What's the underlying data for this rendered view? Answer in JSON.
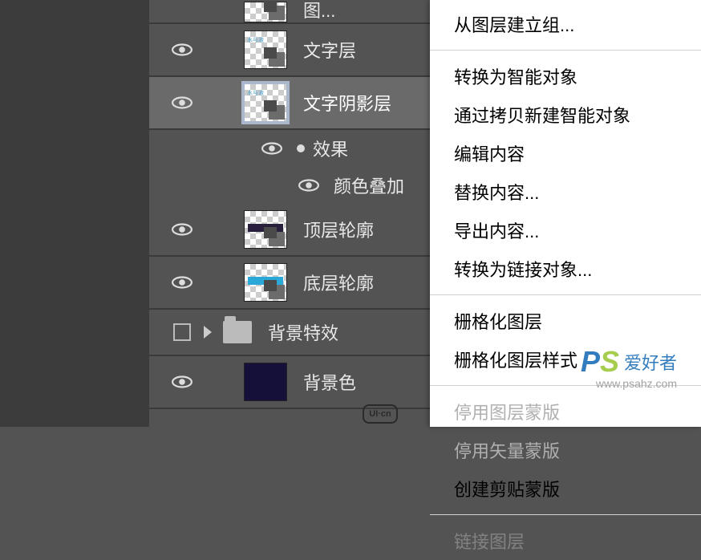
{
  "layers": {
    "cropped_top_label": "图...",
    "text_layer": "文字层",
    "text_shadow_layer": "文字阴影层",
    "fx_label": "效果",
    "color_overlay": "颜色叠加",
    "top_contour": "顶层轮廓",
    "bottom_contour": "底层轮廓",
    "bg_fx_group": "背景特效",
    "bg_color": "背景色"
  },
  "menu": {
    "group_from_layers": "从图层建立组...",
    "convert_smart_object": "转换为智能对象",
    "new_smart_via_copy": "通过拷贝新建智能对象",
    "edit_contents": "编辑内容",
    "replace_contents": "替换内容...",
    "export_contents": "导出内容...",
    "convert_linked": "转换为链接对象...",
    "rasterize_layer": "栅格化图层",
    "rasterize_style": "栅格化图层样式",
    "disable_layer_mask": "停用图层蒙版",
    "disable_vector_mask": "停用矢量蒙版",
    "create_clipping_mask": "创建剪贴蒙版",
    "link_layers_cropped": "链接图层"
  },
  "thumb_text": "水与液",
  "watermark": {
    "brand": "PS",
    "name": "爱好者",
    "url": "www.psahz.com"
  },
  "uicn": "UI·cn"
}
